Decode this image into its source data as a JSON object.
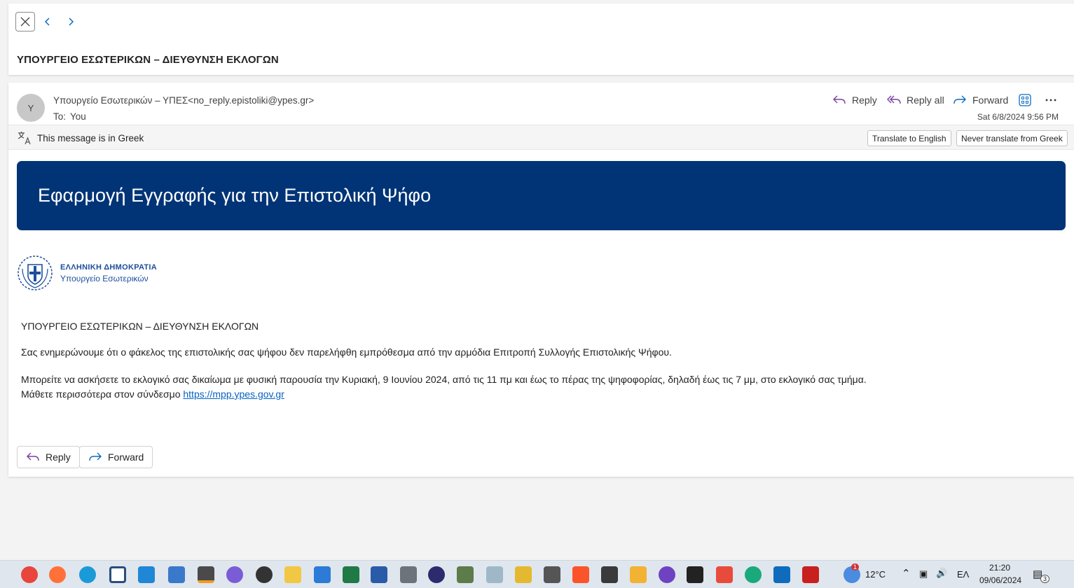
{
  "header": {
    "subject": "ΥΠΟΥΡΓΕΙΟ ΕΣΩΤΕΡΙΚΩΝ – ΔΙΕΥΘΥΝΣΗ ΕΚΛΟΓΩΝ"
  },
  "message": {
    "avatar_initial": "Y",
    "sender": "Υπουργείο Εσωτερικών – ΥΠΕΣ<no_reply.epistoliki@ypes.gr>",
    "to_label": "To:",
    "to_value": "You",
    "datetime": "Sat 6/8/2024 9:56 PM",
    "actions": {
      "reply": "Reply",
      "reply_all": "Reply all",
      "forward": "Forward"
    }
  },
  "translate": {
    "notice": "This message is in Greek",
    "translate_button": "Translate to English",
    "never_button": "Never translate from Greek"
  },
  "email_body": {
    "banner_title": "Εφαρμογή Εγγραφής για την Επιστολική Ψήφο",
    "logo_line1": "ΕΛΛΗΝΙΚΗ ΔΗΜΟΚΡΑΤΙΑ",
    "logo_line2": "Υπουργείο Εσωτερικών",
    "heading": "ΥΠΟΥΡΓΕΙΟ ΕΣΩΤΕΡΙΚΩΝ – ΔΙΕΥΘΥΝΣΗ ΕΚΛΟΓΩΝ",
    "paragraph1": "Σας ενημερώνουμε ότι ο φάκελος της επιστολικής σας ψήφου δεν παρελήφθη εμπρόθεσμα από την αρμόδια Επιτροπή Συλλογής Επιστολικής Ψήφου.",
    "paragraph2": "Μπορείτε να ασκήσετε το εκλογικό σας δικαίωμα με φυσική παρουσία την Κυριακή, 9 Ιουνίου 2024, από τις 11 πμ και έως το πέρας της ψηφοφορίας, δηλαδή έως τις 7 μμ, στο εκλογικό σας τμήμα.",
    "paragraph3_prefix": "Μάθετε περισσότερα στον σύνδεσμο ",
    "link": "https://mpp.ypes.gov.gr"
  },
  "footer_actions": {
    "reply": "Reply",
    "forward": "Forward"
  },
  "taskbar": {
    "weather_temp": "12°C",
    "weather_badge": "1",
    "language": "ΕΛ",
    "time": "21:20",
    "date": "09/06/2024",
    "notification_count": "3"
  },
  "colors": {
    "banner": "#003476",
    "accent_reply": "#7b3f9e",
    "accent_forward": "#0f6cbd",
    "link": "#0563c1"
  }
}
